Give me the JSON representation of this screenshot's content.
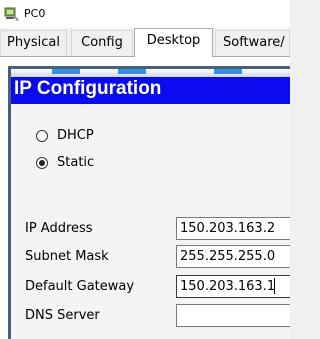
{
  "window": {
    "title": "PC0",
    "icon": "pc-icon"
  },
  "tabs": [
    {
      "label": "Physical"
    },
    {
      "label": "Config"
    },
    {
      "label": "Desktop",
      "active": true
    },
    {
      "label": "Software/"
    }
  ],
  "ip_config": {
    "title": "IP Configuration",
    "mode_options": [
      {
        "label": "DHCP",
        "selected": false
      },
      {
        "label": "Static",
        "selected": true
      }
    ],
    "fields": [
      {
        "label": "IP Address",
        "value": "150.203.163.2"
      },
      {
        "label": "Subnet Mask",
        "value": "255.255.255.0"
      },
      {
        "label": "Default Gateway",
        "value": "150.203.163.1"
      },
      {
        "label": "DNS Server",
        "value": ""
      }
    ]
  },
  "colors": {
    "header_bg": "#0b0bf0",
    "header_text": "#ffffff",
    "dialog_border": "#44627a"
  }
}
